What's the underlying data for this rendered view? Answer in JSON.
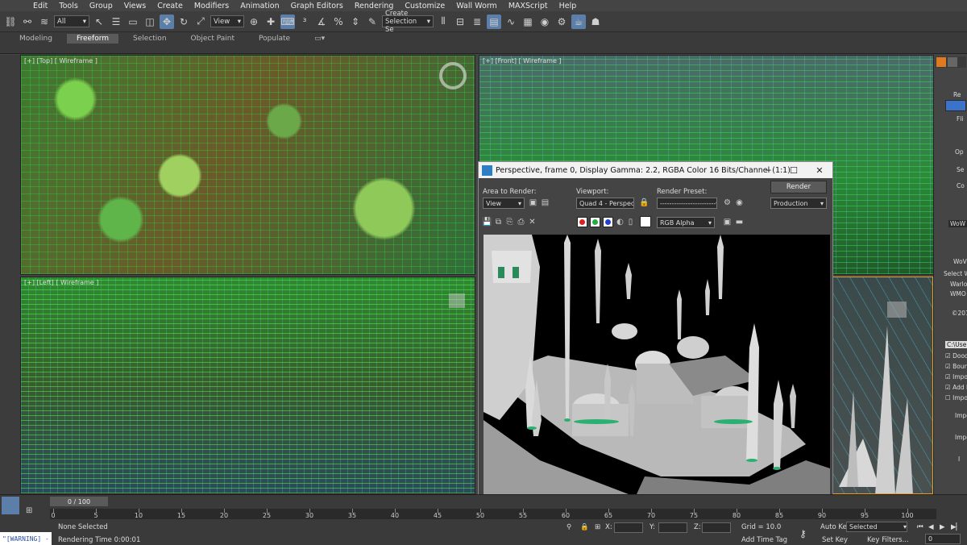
{
  "menu": {
    "items": [
      "Edit",
      "Tools",
      "Group",
      "Views",
      "Create",
      "Modifiers",
      "Animation",
      "Graph Editors",
      "Rendering",
      "Customize",
      "Wall Worm",
      "MAXScript",
      "Help"
    ]
  },
  "toolbar": {
    "selection_filter": "All",
    "reference_coord": "View",
    "named_selection": "Create Selection Se"
  },
  "ribbon": {
    "tabs": [
      "Modeling",
      "Freeform",
      "Selection",
      "Object Paint",
      "Populate"
    ],
    "active_tab": "Freeform"
  },
  "viewports": {
    "top_label": "[+] [Top] [ Wireframe ]",
    "front_label": "[+] [Front] [ Wireframe ]",
    "left_label": "[+] [Left] [ Wireframe ]"
  },
  "render_window": {
    "title": "Perspective, frame 0, Display Gamma: 2.2, RGBA Color 16 Bits/Channel (1:1)",
    "area_label": "Area to Render:",
    "area_value": "View",
    "viewport_label": "Viewport:",
    "viewport_value": "Quad 4 - Perspec",
    "preset_label": "Render Preset:",
    "preset_value": "------------------------",
    "render_button": "Render",
    "production_value": "Production",
    "channel_value": "RGB Alpha",
    "colors": {
      "red": "#e02020",
      "green": "#20b040",
      "blue": "#2040d0"
    }
  },
  "command_panel": {
    "rows": [
      "Re",
      "Fli",
      "Op",
      "Se",
      "Co",
      "WoW V",
      "WoV",
      "Select W",
      "Warlo",
      "WMO",
      "©201",
      "C:\\Use",
      "Dood",
      "Boun",
      "Impo",
      "Add M",
      "Impo",
      "Impo",
      "Impo",
      "I"
    ]
  },
  "timeline": {
    "slider_label": "0 / 100",
    "ticks": [
      0,
      5,
      10,
      15,
      20,
      25,
      30,
      35,
      40,
      45,
      50,
      55,
      60,
      65,
      70,
      75,
      80,
      85,
      90,
      95,
      100
    ]
  },
  "status": {
    "warning": "\"[WARNING] -",
    "selection": "None Selected",
    "render_time": "Rendering Time  0:00:01",
    "x_label": "X:",
    "y_label": "Y:",
    "z_label": "Z:",
    "grid": "Grid = 10.0",
    "add_time_tag": "Add Time Tag",
    "auto_key": "Auto Key",
    "selected": "Selected",
    "set_key": "Set Key",
    "key_filters": "Key Filters...",
    "frame": "0"
  }
}
